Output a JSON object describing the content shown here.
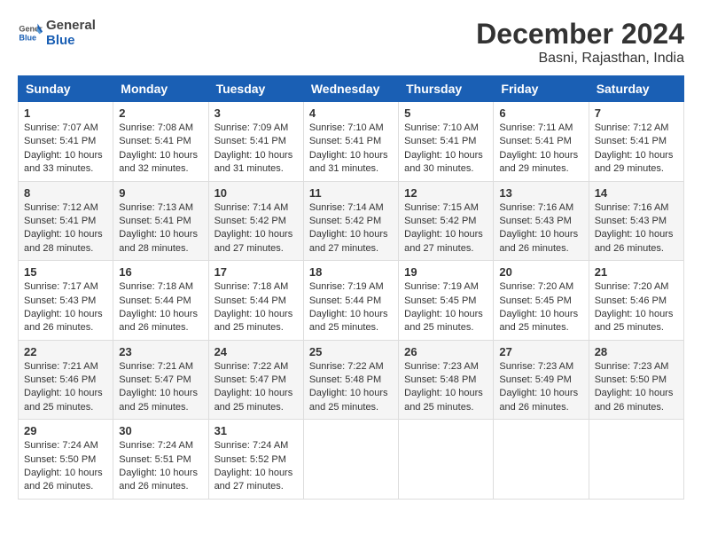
{
  "header": {
    "logo_general": "General",
    "logo_blue": "Blue",
    "title": "December 2024",
    "subtitle": "Basni, Rajasthan, India"
  },
  "days_of_week": [
    "Sunday",
    "Monday",
    "Tuesday",
    "Wednesday",
    "Thursday",
    "Friday",
    "Saturday"
  ],
  "weeks": [
    [
      {
        "day": "1",
        "sunrise": "7:07 AM",
        "sunset": "5:41 PM",
        "daylight": "10 hours and 33 minutes."
      },
      {
        "day": "2",
        "sunrise": "7:08 AM",
        "sunset": "5:41 PM",
        "daylight": "10 hours and 32 minutes."
      },
      {
        "day": "3",
        "sunrise": "7:09 AM",
        "sunset": "5:41 PM",
        "daylight": "10 hours and 31 minutes."
      },
      {
        "day": "4",
        "sunrise": "7:10 AM",
        "sunset": "5:41 PM",
        "daylight": "10 hours and 31 minutes."
      },
      {
        "day": "5",
        "sunrise": "7:10 AM",
        "sunset": "5:41 PM",
        "daylight": "10 hours and 30 minutes."
      },
      {
        "day": "6",
        "sunrise": "7:11 AM",
        "sunset": "5:41 PM",
        "daylight": "10 hours and 29 minutes."
      },
      {
        "day": "7",
        "sunrise": "7:12 AM",
        "sunset": "5:41 PM",
        "daylight": "10 hours and 29 minutes."
      }
    ],
    [
      {
        "day": "8",
        "sunrise": "7:12 AM",
        "sunset": "5:41 PM",
        "daylight": "10 hours and 28 minutes."
      },
      {
        "day": "9",
        "sunrise": "7:13 AM",
        "sunset": "5:41 PM",
        "daylight": "10 hours and 28 minutes."
      },
      {
        "day": "10",
        "sunrise": "7:14 AM",
        "sunset": "5:42 PM",
        "daylight": "10 hours and 27 minutes."
      },
      {
        "day": "11",
        "sunrise": "7:14 AM",
        "sunset": "5:42 PM",
        "daylight": "10 hours and 27 minutes."
      },
      {
        "day": "12",
        "sunrise": "7:15 AM",
        "sunset": "5:42 PM",
        "daylight": "10 hours and 27 minutes."
      },
      {
        "day": "13",
        "sunrise": "7:16 AM",
        "sunset": "5:43 PM",
        "daylight": "10 hours and 26 minutes."
      },
      {
        "day": "14",
        "sunrise": "7:16 AM",
        "sunset": "5:43 PM",
        "daylight": "10 hours and 26 minutes."
      }
    ],
    [
      {
        "day": "15",
        "sunrise": "7:17 AM",
        "sunset": "5:43 PM",
        "daylight": "10 hours and 26 minutes."
      },
      {
        "day": "16",
        "sunrise": "7:18 AM",
        "sunset": "5:44 PM",
        "daylight": "10 hours and 26 minutes."
      },
      {
        "day": "17",
        "sunrise": "7:18 AM",
        "sunset": "5:44 PM",
        "daylight": "10 hours and 25 minutes."
      },
      {
        "day": "18",
        "sunrise": "7:19 AM",
        "sunset": "5:44 PM",
        "daylight": "10 hours and 25 minutes."
      },
      {
        "day": "19",
        "sunrise": "7:19 AM",
        "sunset": "5:45 PM",
        "daylight": "10 hours and 25 minutes."
      },
      {
        "day": "20",
        "sunrise": "7:20 AM",
        "sunset": "5:45 PM",
        "daylight": "10 hours and 25 minutes."
      },
      {
        "day": "21",
        "sunrise": "7:20 AM",
        "sunset": "5:46 PM",
        "daylight": "10 hours and 25 minutes."
      }
    ],
    [
      {
        "day": "22",
        "sunrise": "7:21 AM",
        "sunset": "5:46 PM",
        "daylight": "10 hours and 25 minutes."
      },
      {
        "day": "23",
        "sunrise": "7:21 AM",
        "sunset": "5:47 PM",
        "daylight": "10 hours and 25 minutes."
      },
      {
        "day": "24",
        "sunrise": "7:22 AM",
        "sunset": "5:47 PM",
        "daylight": "10 hours and 25 minutes."
      },
      {
        "day": "25",
        "sunrise": "7:22 AM",
        "sunset": "5:48 PM",
        "daylight": "10 hours and 25 minutes."
      },
      {
        "day": "26",
        "sunrise": "7:23 AM",
        "sunset": "5:48 PM",
        "daylight": "10 hours and 25 minutes."
      },
      {
        "day": "27",
        "sunrise": "7:23 AM",
        "sunset": "5:49 PM",
        "daylight": "10 hours and 26 minutes."
      },
      {
        "day": "28",
        "sunrise": "7:23 AM",
        "sunset": "5:50 PM",
        "daylight": "10 hours and 26 minutes."
      }
    ],
    [
      {
        "day": "29",
        "sunrise": "7:24 AM",
        "sunset": "5:50 PM",
        "daylight": "10 hours and 26 minutes."
      },
      {
        "day": "30",
        "sunrise": "7:24 AM",
        "sunset": "5:51 PM",
        "daylight": "10 hours and 26 minutes."
      },
      {
        "day": "31",
        "sunrise": "7:24 AM",
        "sunset": "5:52 PM",
        "daylight": "10 hours and 27 minutes."
      },
      null,
      null,
      null,
      null
    ]
  ],
  "labels": {
    "sunrise": "Sunrise:",
    "sunset": "Sunset:",
    "daylight": "Daylight:"
  }
}
